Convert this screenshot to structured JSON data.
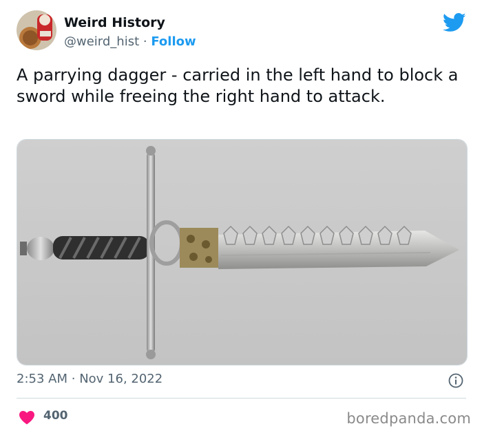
{
  "author": {
    "name": "Weird History",
    "handle": "@weird_hist",
    "separator": "·",
    "follow_label": "Follow",
    "avatar_icon": "avatar-illustration"
  },
  "brand_icon": "twitter-bird-icon",
  "tweet": {
    "text": "A parrying dagger - carried in the left hand to block a sword while freeing the right hand to attack.",
    "media_alt": "photo of a parrying dagger with a serrated blade",
    "time": "2:53 AM",
    "dot": "·",
    "date": "Nov 16, 2022",
    "info_icon": "info-icon"
  },
  "engagement": {
    "likes": "400",
    "like_icon": "heart-icon"
  },
  "watermark": "boredpanda.com",
  "colors": {
    "accent": "#1d9bf0",
    "heart": "#f91880",
    "secondary_text": "#536471",
    "divider": "#cfd9de"
  }
}
